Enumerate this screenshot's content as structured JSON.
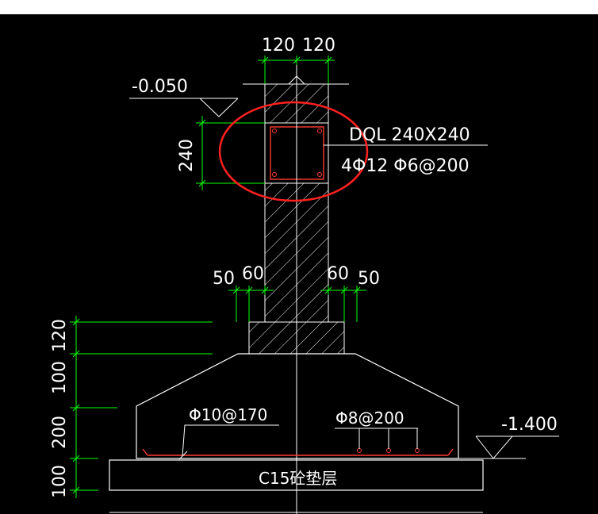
{
  "colors": {
    "background": "#000000",
    "outline": "#ffffff",
    "dimension": "#00ff00",
    "rebar": "#ff3b30",
    "highlight": "#ff2020",
    "text": "#ffffff"
  },
  "elevations": {
    "top": "-0.050",
    "bottom": "-1.400"
  },
  "dimensions": {
    "wall_left": "120",
    "wall_right": "120",
    "beam_height": "240",
    "step_left_outer": "50",
    "step_left_inner": "60",
    "step_right_inner": "60",
    "step_right_outer": "50",
    "height_step": "120",
    "height_slope": "100",
    "height_footing": "200",
    "height_cushion": "100"
  },
  "beam": {
    "name": "DQL 240X240",
    "reinforcement": "4Φ12  Φ6@200"
  },
  "footing": {
    "rebar_left": "Φ10@170",
    "rebar_right": "Φ8@200",
    "cushion_label": "C15砼垫层"
  }
}
